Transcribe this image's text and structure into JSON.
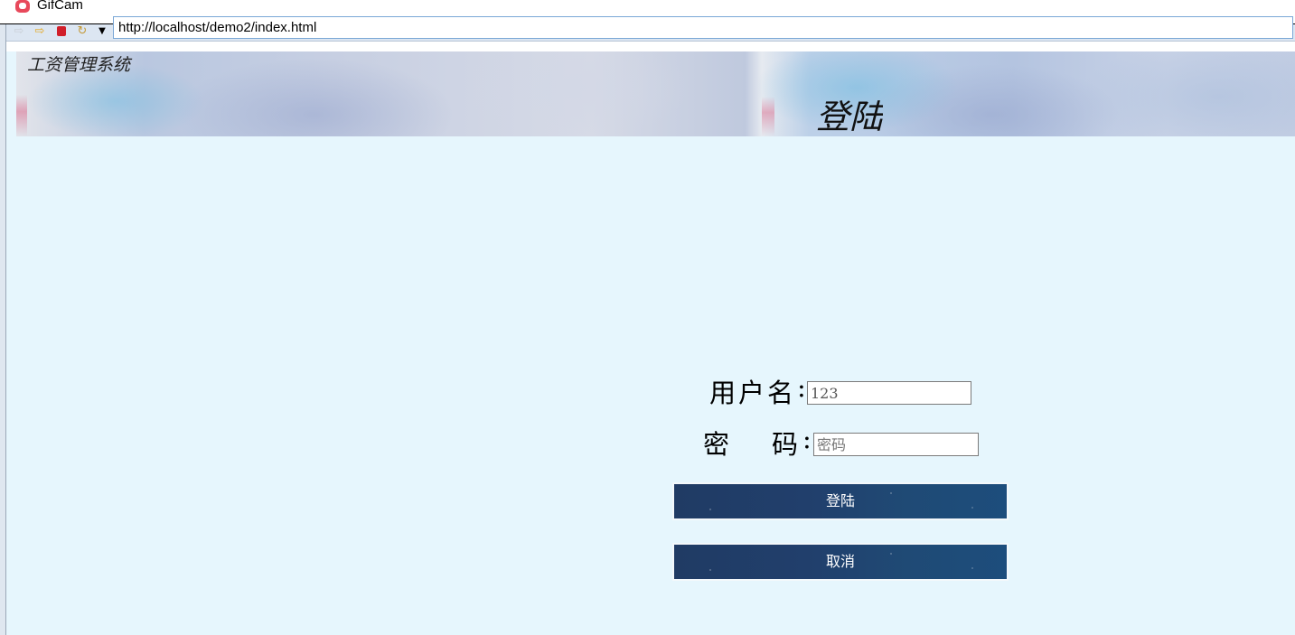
{
  "window": {
    "title": "GifCam"
  },
  "browser": {
    "address": "http://localhost/demo2/index.html",
    "toolbar_icons": [
      "back-arrow-icon",
      "forward-arrow-icon",
      "stop-icon",
      "refresh-icon",
      "dropdown-arrow-icon"
    ]
  },
  "banner": {
    "system_name": "工资管理系统",
    "heading": "登陆"
  },
  "form": {
    "username_label": "用户名",
    "password_label_1": "密",
    "password_label_2": "码",
    "colon": ":",
    "username_value": "123",
    "password_placeholder": "密码",
    "login_button": "登陆",
    "cancel_button": "取消"
  },
  "colors": {
    "page_background": "#e6f6fd",
    "button_background": "#203b64",
    "button_text": "#ffffff"
  }
}
